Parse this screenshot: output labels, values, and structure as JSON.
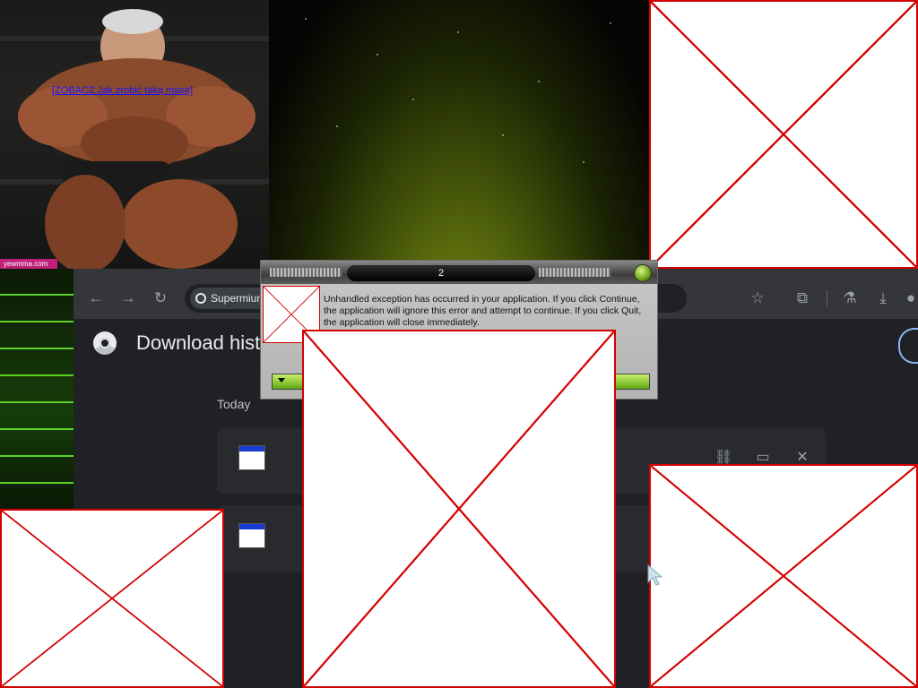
{
  "photo": {
    "link_text": "[ZOBACZ Jak zrobić taką masę]",
    "watermark": "yewmma.com"
  },
  "browser": {
    "omnibox": {
      "chip_label": "Supermium"
    },
    "page_title": "Download history",
    "sections": [
      {
        "label": "Today"
      }
    ],
    "downloads": [
      {
        "icon": "window-app-icon"
      },
      {
        "icon": "window-app-icon"
      }
    ],
    "toolbar_icons": [
      "back-icon",
      "forward-icon",
      "reload-icon",
      "star-icon",
      "extensions-icon",
      "labs-icon",
      "download-icon",
      "profile-icon"
    ],
    "card_action_icons": [
      "link-icon",
      "folder-icon",
      "close-icon"
    ]
  },
  "dialog": {
    "title": "2",
    "message": "Unhandled exception has occurred in your application. If you click Continue, the application will ignore this error and attempt to continue. If you click Quit, the application will close immediately."
  },
  "colors": {
    "broken_image_border": "#d40000",
    "browser_bg": "#202124",
    "dialog_accent": "#6aa314"
  }
}
